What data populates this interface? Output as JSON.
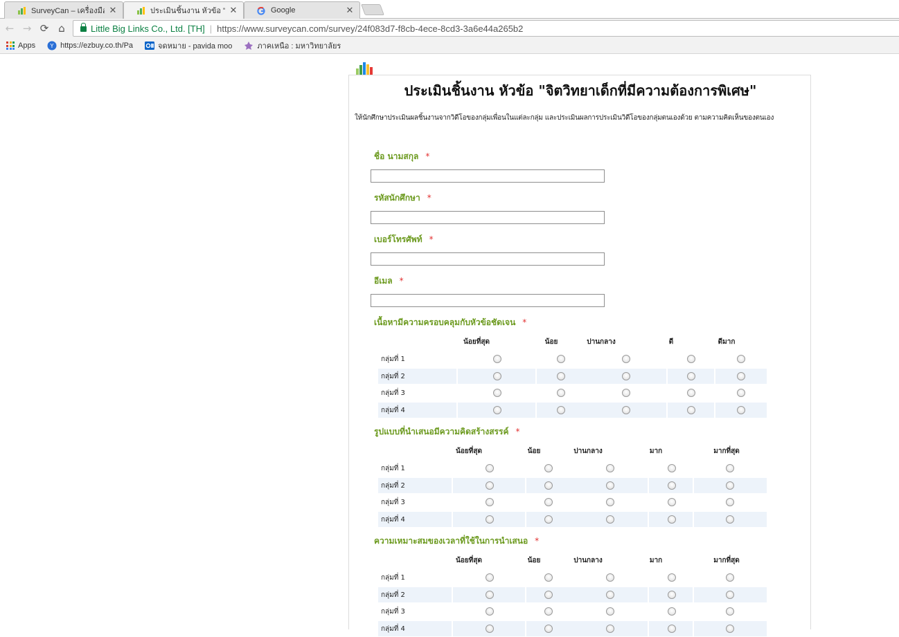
{
  "browser": {
    "tabs": [
      {
        "title": "SurveyCan – เครื่องมือในการ",
        "active": false
      },
      {
        "title": "ประเมินชิ้นงาน หัวข้อ \"จิตวิทย",
        "active": true
      },
      {
        "title": "Google",
        "active": false
      }
    ],
    "address": {
      "site_identity": "Little Big Links Co., Ltd. [TH]",
      "separator": "|",
      "url": "https://www.surveycan.com/survey/24f083d7-f8cb-4ece-8cd3-3a6e44a265b2"
    },
    "bookmarks": [
      {
        "label": "Apps",
        "icon": "apps-grid-icon"
      },
      {
        "label": "https://ezbuy.co.th/Pa",
        "icon": "ezbuy-icon"
      },
      {
        "label": "จดหมาย - pavida moo",
        "icon": "outlook-icon"
      },
      {
        "label": "ภาคเหนือ : มหาวิทยาลัยร",
        "icon": "university-icon"
      }
    ]
  },
  "survey": {
    "title": "ประเมินชิ้นงาน หัวข้อ \"จิตวิทยาเด็กที่มีความต้องการพิเศษ\"",
    "description": "ให้นักศึกษาประเมินผลชิ้นงานจากวิดีโอของกลุ่มเพื่อนในแต่ละกลุ่ม และประเมินผลการประเมินวิดีโอของกลุ่มตนเองด้วย ตามความคิดเห็นของตนเอง",
    "required_mark": "*",
    "text_fields": [
      {
        "label": "ชื่อ นามสกุล",
        "value": ""
      },
      {
        "label": "รหัสนักศึกษา",
        "value": ""
      },
      {
        "label": "เบอร์โทรศัพท์",
        "value": ""
      },
      {
        "label": "อีเมล",
        "value": ""
      }
    ],
    "matrices": [
      {
        "label": "เนื้อหามีความครอบคลุมกับหัวข้อชัดเจน",
        "columns": [
          "น้อยที่สุด",
          "น้อย",
          "ปานกลาง",
          "ดี",
          "ดีมาก"
        ],
        "rows": [
          "กลุ่มที่ 1",
          "กลุ่มที่ 2",
          "กลุ่มที่ 3",
          "กลุ่มที่ 4"
        ]
      },
      {
        "label": "รูปแบบที่นำเสนอมีความคิดสร้างสรรค์",
        "columns": [
          "น้อยที่สุด",
          "น้อย",
          "ปานกลาง",
          "มาก",
          "มากที่สุด"
        ],
        "rows": [
          "กลุ่มที่ 1",
          "กลุ่มที่ 2",
          "กลุ่มที่ 3",
          "กลุ่มที่ 4"
        ]
      },
      {
        "label": "ความเหมาะสมของเวลาที่ใช้ในการนำเสนอ",
        "columns": [
          "น้อยที่สุด",
          "น้อย",
          "ปานกลาง",
          "มาก",
          "มากที่สุด"
        ],
        "rows": [
          "กลุ่มที่ 1",
          "กลุ่มที่ 2",
          "กลุ่มที่ 3",
          "กลุ่มที่ 4"
        ]
      }
    ]
  }
}
